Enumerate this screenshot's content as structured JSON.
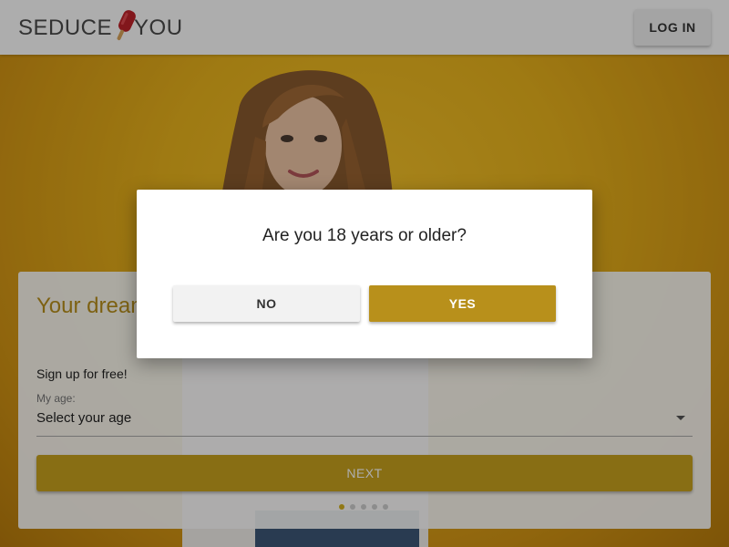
{
  "header": {
    "logo_left": "SEDUCE",
    "logo_right": "YOU",
    "login_label": "LOG IN"
  },
  "signup": {
    "title": "Your dream date is waiting",
    "subtitle": "Sign up for free!",
    "age_label": "My age:",
    "age_value": "Select your age",
    "next_label": "NEXT",
    "steps_total": 5,
    "step_active": 1
  },
  "age_gate": {
    "question": "Are you 18 years or older?",
    "no_label": "NO",
    "yes_label": "YES"
  },
  "colors": {
    "accent": "#b8901b",
    "hero_bg": "#eab41c"
  },
  "icons": {
    "logo": "popsicle-icon",
    "caret": "chevron-down-icon"
  }
}
